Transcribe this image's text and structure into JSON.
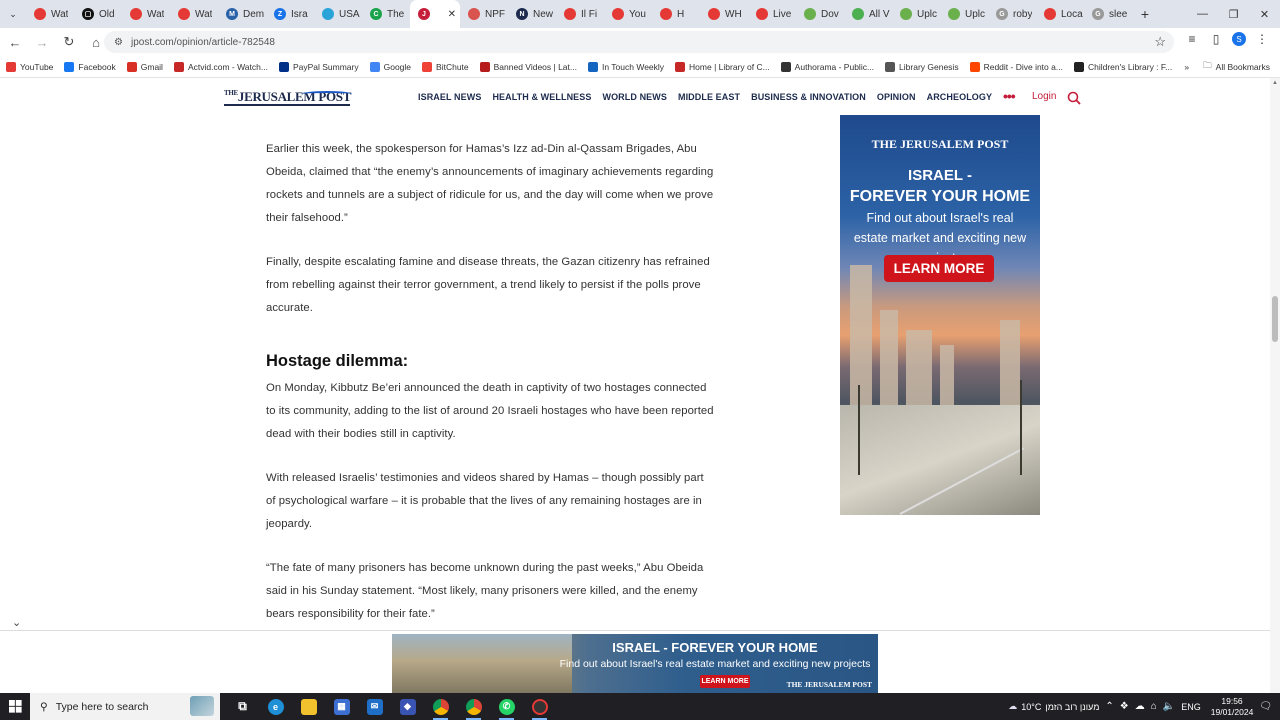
{
  "browser": {
    "tabs": [
      {
        "title": "Wat",
        "color": "#e53935",
        "glyph": ""
      },
      {
        "title": "Old",
        "color": "#111111",
        "glyph": "▢"
      },
      {
        "title": "Wat",
        "color": "#e53935",
        "glyph": ""
      },
      {
        "title": "Wat",
        "color": "#e53935",
        "glyph": ""
      },
      {
        "title": "Dem",
        "color": "#2962a8",
        "glyph": "M"
      },
      {
        "title": "Isra",
        "color": "#1a73e8",
        "glyph": "Z"
      },
      {
        "title": "USA",
        "color": "#2aa3d8",
        "glyph": ""
      },
      {
        "title": "The",
        "color": "#1aa34a",
        "glyph": "C"
      },
      {
        "title": "",
        "color": "#c41e3a",
        "glyph": "J",
        "active": true
      },
      {
        "title": "NPF",
        "color": "#d9534f",
        "glyph": ""
      },
      {
        "title": "New",
        "color": "#1c2a4d",
        "glyph": "N"
      },
      {
        "title": "Il Fi",
        "color": "#e53935",
        "glyph": ""
      },
      {
        "title": "You",
        "color": "#e53935",
        "glyph": ""
      },
      {
        "title": "H",
        "color": "#e53935",
        "glyph": ""
      },
      {
        "title": "WH",
        "color": "#e53935",
        "glyph": ""
      },
      {
        "title": "Live",
        "color": "#e53935",
        "glyph": ""
      },
      {
        "title": "Dov",
        "color": "#6ab04c",
        "glyph": ""
      },
      {
        "title": "All V",
        "color": "#4caf50",
        "glyph": ""
      },
      {
        "title": "Uplc",
        "color": "#6ab04c",
        "glyph": ""
      },
      {
        "title": "Uplc",
        "color": "#6ab04c",
        "glyph": ""
      },
      {
        "title": "roby",
        "color": "#999999",
        "glyph": "G"
      },
      {
        "title": "Loca",
        "color": "#e53935",
        "glyph": ""
      },
      {
        "title": "slee",
        "color": "#999999",
        "glyph": "G"
      }
    ],
    "new_tab": "+",
    "close_tab": "✕",
    "url": "jpost.com/opinion/article-782548",
    "bookmarks": [
      {
        "label": "YouTube",
        "color": "#e53935"
      },
      {
        "label": "Facebook",
        "color": "#1877f2"
      },
      {
        "label": "Gmail",
        "color": "#d93025"
      },
      {
        "label": "Actvid.com - Watch...",
        "color": "#c62828"
      },
      {
        "label": "PayPal Summary",
        "color": "#003087"
      },
      {
        "label": "Google",
        "color": "#4285f4"
      },
      {
        "label": "BitChute",
        "color": "#ef4136"
      },
      {
        "label": "Banned Videos | Lat...",
        "color": "#b71c1c"
      },
      {
        "label": "In Touch Weekly",
        "color": "#1565c0"
      },
      {
        "label": "Home | Library of C...",
        "color": "#c62828"
      },
      {
        "label": "Authorama - Public...",
        "color": "#333333"
      },
      {
        "label": "Library Genesis",
        "color": "#555555"
      },
      {
        "label": "Reddit - Dive into a...",
        "color": "#ff4500"
      },
      {
        "label": "Children's Library : F...",
        "color": "#222222"
      }
    ],
    "bookmarks_more": "»",
    "all_bookmarks": "All Bookmarks"
  },
  "site": {
    "logo_the": "THE",
    "logo_name": "JERUSALEM POST",
    "nav": [
      "ISRAEL NEWS",
      "HEALTH & WELLNESS",
      "WORLD NEWS",
      "MIDDLE EAST",
      "BUSINESS & INNOVATION",
      "OPINION",
      "ARCHEOLOGY"
    ],
    "more": "•••",
    "login": "Login"
  },
  "article": {
    "p1": "Earlier this week, the spokesperson for Hamas’s Izz ad-Din al-Qassam Brigades, Abu Obeida, claimed that “the enemy’s announcements of imaginary achievements regarding rockets and tunnels are a subject of ridicule for us, and the day will come when we prove their falsehood.”",
    "p2": "Finally, despite escalating famine and disease threats, the Gazan citizenry has refrained from rebelling against their terror government, a trend likely to persist if the polls prove accurate.",
    "h2": "Hostage dilemma:",
    "p3": "On Monday, Kibbutz Be’eri announced the death in captivity of two hostages connected to its community, adding to the list of around 20 Israeli hostages who have been reported dead with their bodies still in captivity.",
    "p4": "With released Israelis’ testimonies and videos shared by Hamas – though possibly part of psychological warfare – it is probable that the lives of any remaining hostages are in jeopardy.",
    "p5": "“The fate of many prisoners has become unknown during the past weeks,” Abu Obeida said in his Sunday statement. “Most likely, many prisoners were killed, and the enemy bears responsibility for their fate.”"
  },
  "side_ad": {
    "logo": "THE JERUSALEM POST",
    "headline1": "ISRAEL -",
    "headline2": "FOREVER YOUR HOME",
    "sub": "Find out about Israel's real estate market and exciting new projects",
    "button": "LEARN MORE"
  },
  "bottom_ad": {
    "headline": "ISRAEL - FOREVER YOUR HOME",
    "sub": "Find out about Israel's real estate market and exciting new projects",
    "button": "LEARN MORE",
    "logo": "THE JERUSALEM POST"
  },
  "taskbar": {
    "search_placeholder": "Type here to search",
    "weather": "10°C",
    "weather_desc": "מעונן רוב הזמן",
    "lang": "ENG",
    "time": "19:56",
    "date": "19/01/2024"
  }
}
